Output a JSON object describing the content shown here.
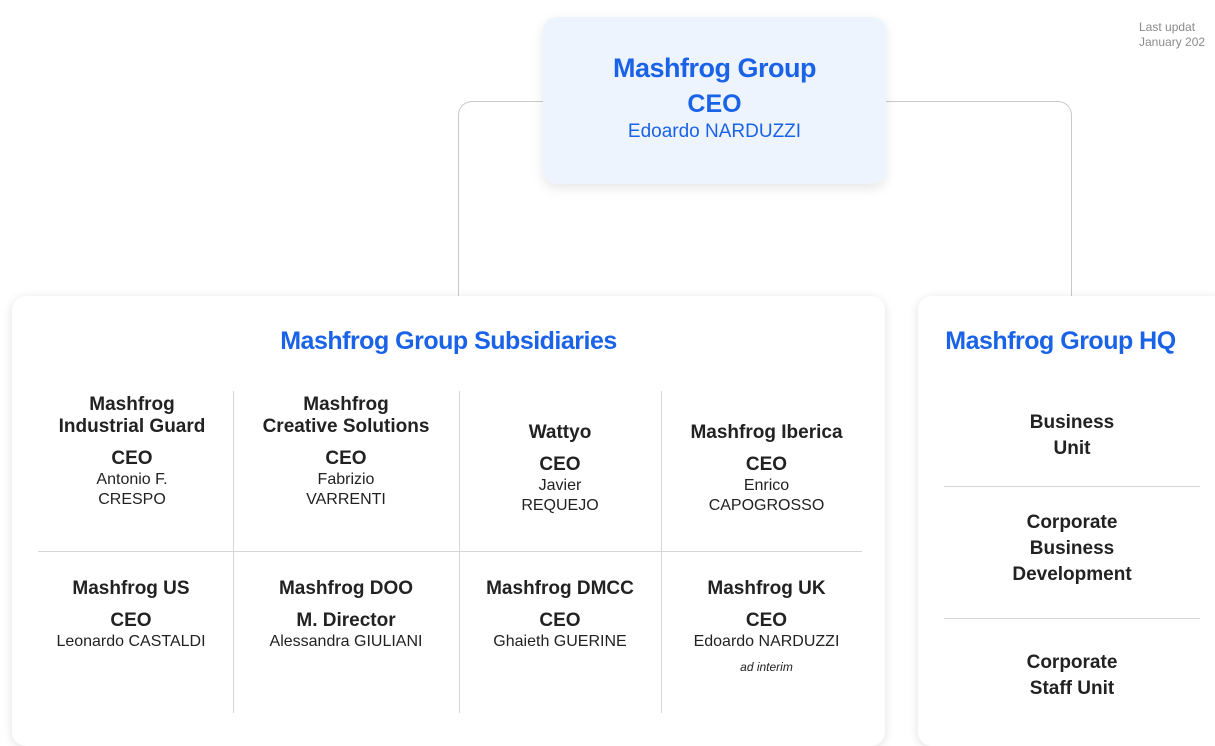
{
  "last_updated": {
    "line1": "Last updat",
    "line2": "January 202"
  },
  "top": {
    "org": "Mashfrog Group",
    "role": "CEO",
    "person": "Edoardo NARDUZZI"
  },
  "subsidiaries": {
    "title": "Mashfrog Group Subsidiaries",
    "row1": [
      {
        "name1": "Mashfrog",
        "name2": "Industrial Guard",
        "role": "CEO",
        "person1": "Antonio F.",
        "person2": "CRESPO"
      },
      {
        "name1": "Mashfrog",
        "name2": "Creative Solutions",
        "role": "CEO",
        "person1": "Fabrizio",
        "person2": "VARRENTI"
      },
      {
        "name1": "",
        "name2": "Wattyo",
        "role": "CEO",
        "person1": "Javier",
        "person2": "REQUEJO"
      },
      {
        "name1": "",
        "name2": "Mashfrog  Iberica",
        "role": "CEO",
        "person1": "Enrico",
        "person2": "CAPOGROSSO"
      }
    ],
    "row2": [
      {
        "name": "Mashfrog US",
        "role": "CEO",
        "person": "Leonardo CASTALDI",
        "note": ""
      },
      {
        "name": "Mashfrog DOO",
        "role": "M. Director",
        "person": "Alessandra GIULIANI",
        "note": ""
      },
      {
        "name": "Mashfrog DMCC",
        "role": "CEO",
        "person": "Ghaieth GUERINE",
        "note": ""
      },
      {
        "name": "Mashfrog UK",
        "role": "CEO",
        "person": "Edoardo NARDUZZI",
        "note": "ad interim"
      }
    ]
  },
  "hq": {
    "title": "Mashfrog Group HQ",
    "items": [
      {
        "line1": "Business",
        "line2": "Unit",
        "line3": ""
      },
      {
        "line1": "Corporate",
        "line2": "Business",
        "line3": "Development"
      },
      {
        "line1": "Corporate",
        "line2": "Staff Unit",
        "line3": ""
      }
    ]
  }
}
